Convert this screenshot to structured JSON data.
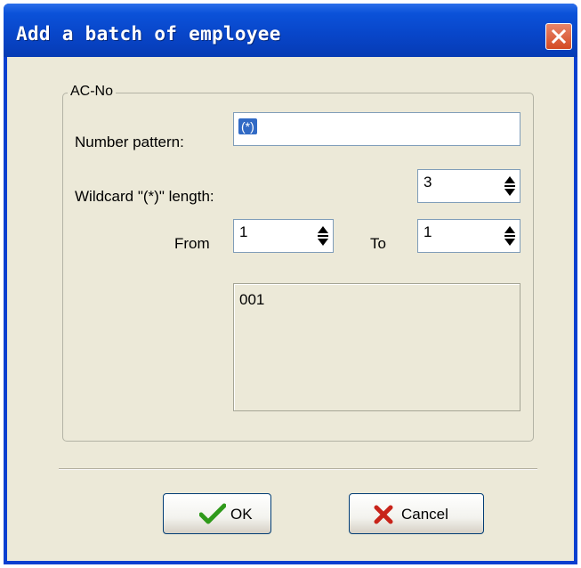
{
  "window": {
    "title": "Add a batch of employee"
  },
  "group": {
    "title": "AC-No"
  },
  "form": {
    "number_pattern_label": "Number pattern:",
    "number_pattern_value": "(*)",
    "wildcard_label": "Wildcard \"(*)\" length:",
    "wildcard_value": "3",
    "from_label": "From",
    "from_value": "1",
    "to_label": "To",
    "to_value": "1"
  },
  "preview": {
    "items": [
      "001"
    ]
  },
  "buttons": {
    "ok_label": "OK",
    "cancel_label": "Cancel"
  },
  "icons": {
    "close": "close-icon",
    "ok": "checkmark-icon",
    "cancel": "x-icon",
    "spin": "spin-arrows-icon"
  },
  "colors": {
    "titlebar": "#0845c8",
    "client": "#ece9d8",
    "close": "#d44a22",
    "ok_check": "#2f9a1a",
    "cancel_x": "#c8241a"
  }
}
